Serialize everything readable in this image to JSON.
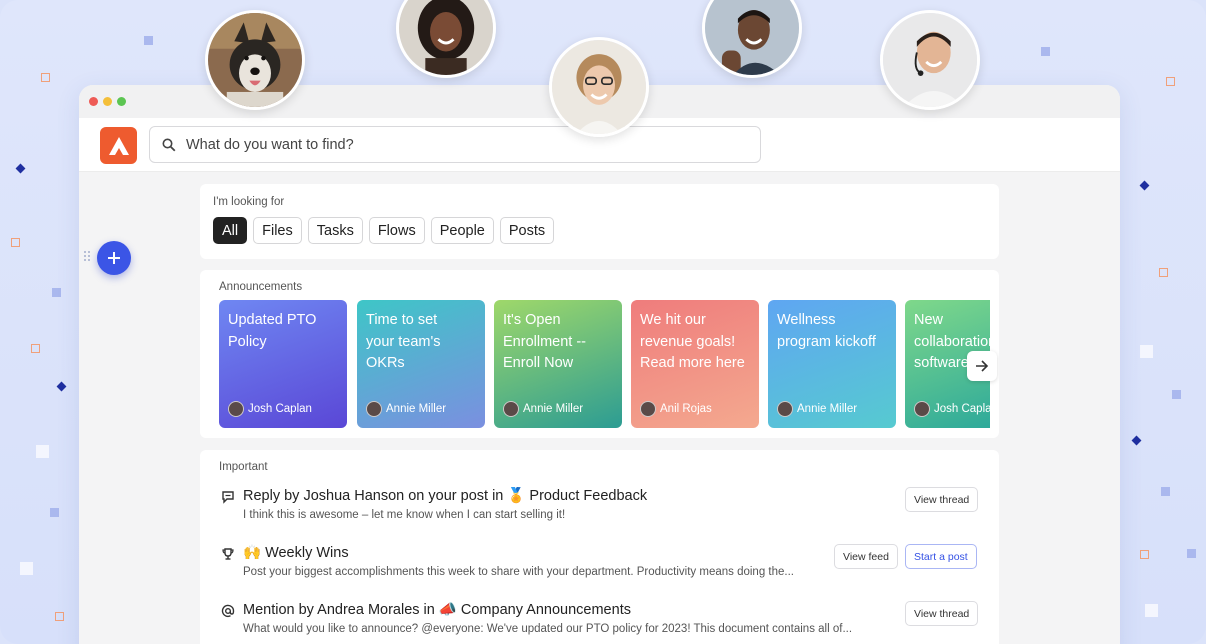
{
  "search": {
    "placeholder": "What do you want to find?"
  },
  "filter": {
    "label": "I'm looking for",
    "chips": [
      "All",
      "Files",
      "Tasks",
      "Flows",
      "People",
      "Posts"
    ]
  },
  "announcements": {
    "label": "Announcements",
    "tiles": [
      {
        "title": "Updated PTO Policy",
        "author": "Josh Caplan"
      },
      {
        "title": "Time to set your team's OKRs",
        "author": "Annie Miller"
      },
      {
        "title": "It's Open Enrollment -- Enroll Now",
        "author": "Annie Miller"
      },
      {
        "title": "We hit our revenue goals! Read more here",
        "author": "Anil Rojas"
      },
      {
        "title": "Wellness program kickoff",
        "author": "Annie Miller"
      },
      {
        "title": "New collaboration software",
        "author": "Josh Caplan"
      }
    ]
  },
  "important": {
    "label": "Important",
    "items": [
      {
        "pre": "Reply by Joshua Hanson on your post in",
        "emoji": "🏅",
        "post": "Product Feedback",
        "sub": "I think this is awesome – let me know when I can start selling it!",
        "buttons": [
          "View thread"
        ]
      },
      {
        "pre": "",
        "emoji": "🙌",
        "post": "Weekly Wins",
        "sub": "Post your biggest accomplishments this week to share with your department. Productivity means doing the...",
        "buttons": [
          "View feed",
          "Start a post"
        ]
      },
      {
        "pre": "Mention by Andrea Morales in",
        "emoji": "📣",
        "post": "Company Announcements",
        "sub": "What would you like to announce? @everyone: We've updated our PTO policy for 2023! This document contains all of...",
        "buttons": [
          "View thread"
        ]
      }
    ]
  },
  "colors": {
    "accent": "#3b55e6",
    "logo": "#ee5b2f",
    "background": "#dbe3fa"
  }
}
